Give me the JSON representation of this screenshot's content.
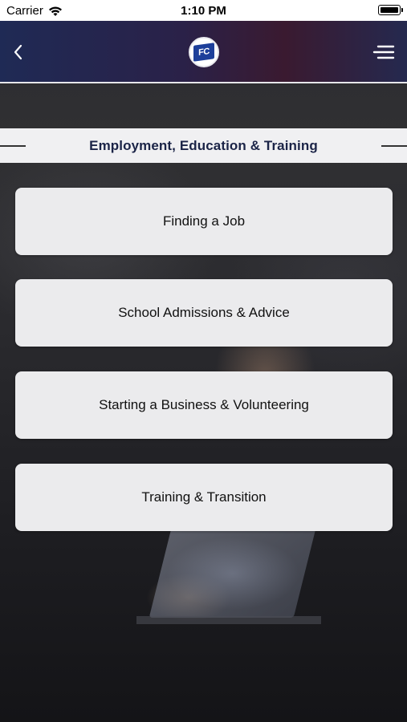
{
  "status_bar": {
    "carrier": "Carrier",
    "time": "1:10 PM"
  },
  "nav": {
    "logo_text": "FC",
    "back_icon": "chevron-left-icon",
    "menu_icon": "hamburger-menu-icon"
  },
  "section": {
    "title": "Employment, Education & Training"
  },
  "items": [
    {
      "label": "Finding a Job"
    },
    {
      "label": "School Admissions & Advice"
    },
    {
      "label": "Starting a Business & Volunteering"
    },
    {
      "label": "Training & Transition"
    }
  ],
  "colors": {
    "nav_background": "#1f2a55",
    "header_text": "#1b2447",
    "card_background": "#ebebed",
    "logo_blue": "#1d3f9a"
  }
}
